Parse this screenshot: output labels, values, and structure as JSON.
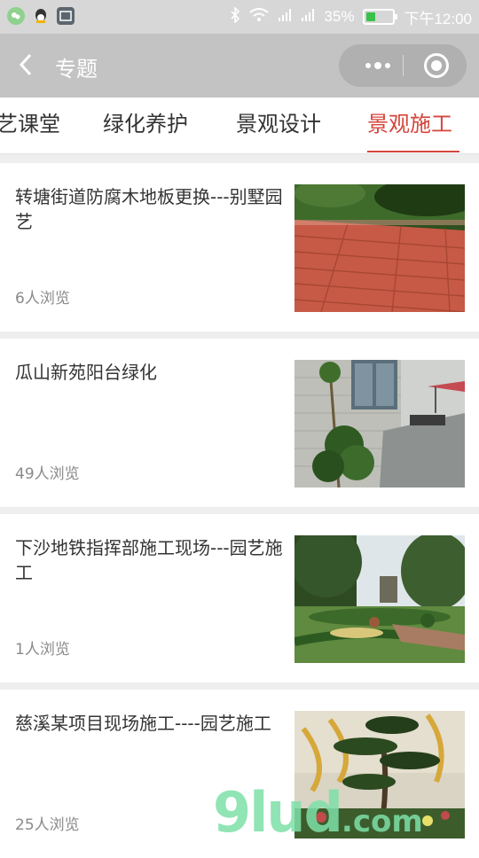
{
  "status": {
    "battery": "35%",
    "time": "下午12:00",
    "battery_level": 0.35
  },
  "nav": {
    "title": "专题"
  },
  "tabs": [
    {
      "label": "艺课堂"
    },
    {
      "label": "绿化养护"
    },
    {
      "label": "景观设计"
    },
    {
      "label": "景观施工",
      "active": true
    }
  ],
  "articles": [
    {
      "title": "转塘街道防腐木地板更换---别墅园艺",
      "views": "6人浏览",
      "image": "wooden-deck-photo"
    },
    {
      "title": "瓜山新苑阳台绿化",
      "views": "49人浏览",
      "image": "balcony-plant-photo"
    },
    {
      "title": "下沙地铁指挥部施工现场---园艺施工",
      "views": "1人浏览",
      "image": "garden-hedge-photo"
    },
    {
      "title": "慈溪某项目现场施工----园艺施工",
      "views": "25人浏览",
      "image": "bonsai-pine-photo"
    }
  ],
  "watermark": {
    "main": "9lud",
    "suffix": ".com"
  },
  "colors": {
    "accent": "#d5453b",
    "nav_bg": "#c3c3c3",
    "status_bg": "#d7d7d7"
  }
}
